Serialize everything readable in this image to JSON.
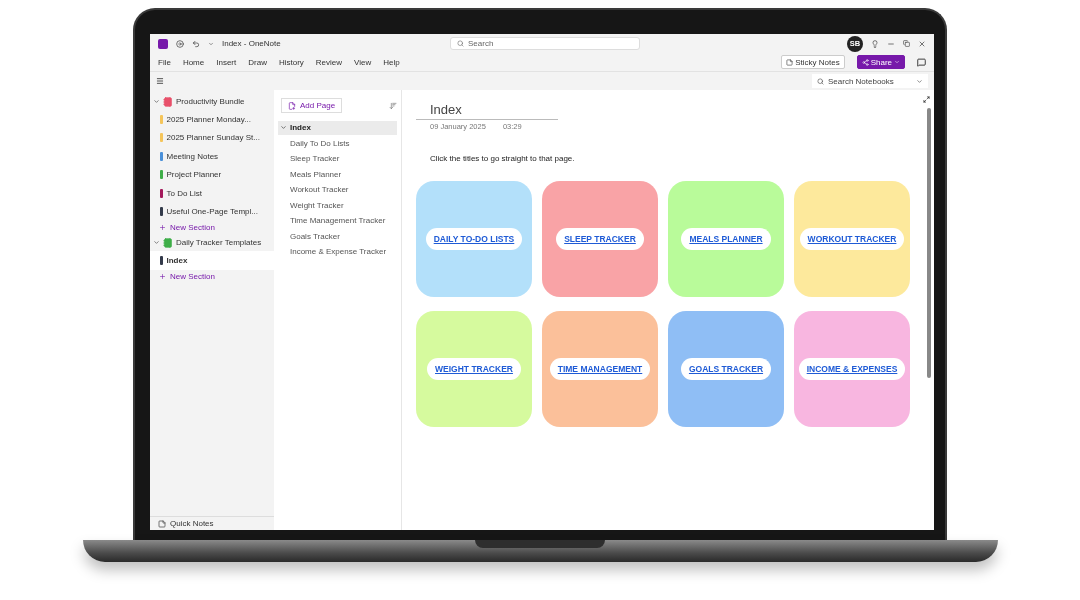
{
  "window": {
    "title": "Index - OneNote",
    "search_placeholder": "Search",
    "account": "SB"
  },
  "menu": [
    {
      "label": "File",
      "selected": false
    },
    {
      "label": "Home",
      "selected": false
    },
    {
      "label": "Insert",
      "selected": false
    },
    {
      "label": "Draw",
      "selected": false
    },
    {
      "label": "History",
      "selected": false
    },
    {
      "label": "Review",
      "selected": false
    },
    {
      "label": "View",
      "selected": false
    },
    {
      "label": "Help",
      "selected": false
    }
  ],
  "ribbon_buttons": {
    "sticky_notes": "Sticky Notes",
    "share": "Share"
  },
  "notebook_search": {
    "placeholder": "Search Notebooks"
  },
  "notebooks": [
    {
      "name": "Productivity Bundle",
      "color": "#e8516a",
      "expanded": true,
      "selected": false,
      "new_section": "New Section",
      "sections": [
        {
          "name": "2025 Planner Monday...",
          "color": "#f5c55a",
          "selected": false
        },
        {
          "name": "2025 Planner Sunday St...",
          "color": "#f5c55a",
          "selected": false
        },
        {
          "name": "Meeting Notes",
          "color": "#4a90d9",
          "selected": false
        },
        {
          "name": "Project Planner",
          "color": "#3fae49",
          "selected": false
        },
        {
          "name": "To Do List",
          "color": "#a3195b",
          "selected": false
        },
        {
          "name": "Useful One-Page Templ...",
          "color": "#333a4a",
          "selected": false
        }
      ]
    },
    {
      "name": "Daily Tracker Templates",
      "color": "#3fae49",
      "expanded": true,
      "selected": false,
      "new_section": "New Section",
      "sections": [
        {
          "name": "Index",
          "color": "#333a4a",
          "selected": true
        }
      ]
    }
  ],
  "quick_notes": "Quick Notes",
  "add_page": "Add Page",
  "pages": [
    {
      "title": "Index",
      "selected": true,
      "expanded": true,
      "children": [
        {
          "title": "Daily To Do Lists",
          "selected": false
        },
        {
          "title": "Sleep Tracker",
          "selected": false
        },
        {
          "title": "Meals Planner",
          "selected": false
        },
        {
          "title": "Workout Tracker",
          "selected": false
        },
        {
          "title": "Weight Tracker",
          "selected": false
        },
        {
          "title": "Time Management Tracker",
          "selected": false
        },
        {
          "title": "Goals Tracker",
          "selected": false
        },
        {
          "title": "Income & Expense Tracker",
          "selected": false
        }
      ]
    }
  ],
  "page": {
    "title": "Index",
    "date": "09 January 2025",
    "time": "03:29",
    "instruction": "Click the titles to go straight to that page."
  },
  "tiles": [
    {
      "label": "DAILY TO-DO LISTS",
      "color": "#b3e0fa"
    },
    {
      "label": "SLEEP TRACKER",
      "color": "#f9a3a6"
    },
    {
      "label": "MEALS PLANNER",
      "color": "#b9fb9a"
    },
    {
      "label": "WORKOUT TRACKER",
      "color": "#fde99c"
    },
    {
      "label": "WEIGHT TRACKER",
      "color": "#d6fa9e"
    },
    {
      "label": "TIME MANAGEMENT",
      "color": "#fbc09a"
    },
    {
      "label": "GOALS TRACKER",
      "color": "#8fbef5"
    },
    {
      "label": "INCOME & EXPENSES",
      "color": "#f8b6e0"
    }
  ]
}
